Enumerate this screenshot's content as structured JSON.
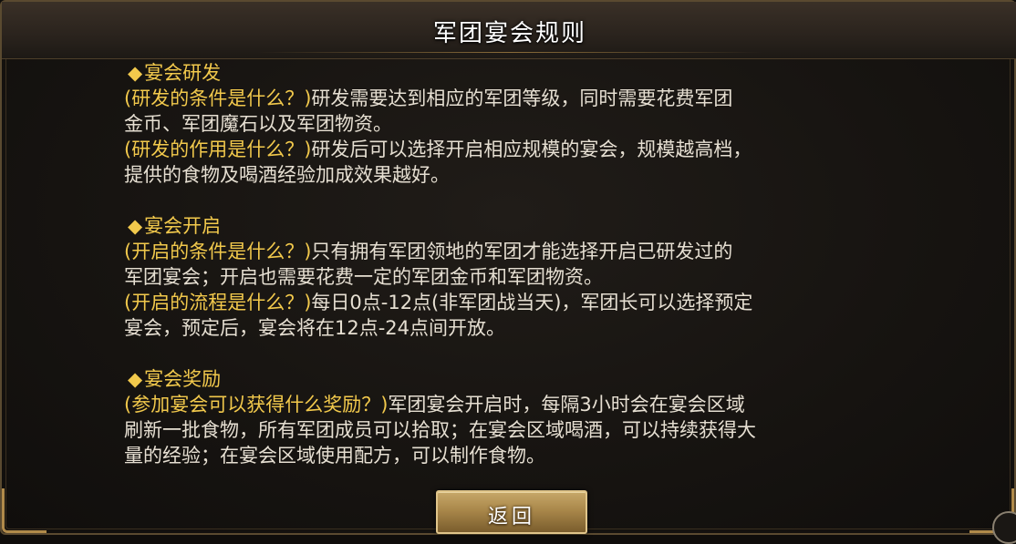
{
  "header": {
    "title": "军团宴会规则"
  },
  "sections": [
    {
      "heading": "宴会研发",
      "lines": [
        {
          "q": " (研发的条件是什么？)",
          "t": "研发需要达到相应的军团等级，同时需要花费军团"
        },
        {
          "q": "",
          "t": "金币、军团魔石以及军团物资。"
        },
        {
          "q": "(研发的作用是什么？)",
          "t": "研发后可以选择开启相应规模的宴会，规模越高档，"
        },
        {
          "q": "",
          "t": "提供的食物及喝酒经验加成效果越好。"
        }
      ]
    },
    {
      "heading": "宴会开启",
      "lines": [
        {
          "q": " (开启的条件是什么？)",
          "t": "只有拥有军团领地的军团才能选择开启已研发过的"
        },
        {
          "q": "",
          "t": "军团宴会；开启也需要花费一定的军团金币和军团物资。"
        },
        {
          "q": "(开启的流程是什么？)",
          "t": "每日0点-12点(非军团战当天)，军团长可以选择预定"
        },
        {
          "q": "",
          "t": "宴会，预定后，宴会将在12点-24点间开放。"
        }
      ]
    },
    {
      "heading": "宴会奖励",
      "lines": [
        {
          "q": "(参加宴会可以获得什么奖励？)",
          "t": "军团宴会开启时，每隔3小时会在宴会区域"
        },
        {
          "q": "",
          "t": "刷新一批食物，所有军团成员可以拾取；在宴会区域喝酒，可以持续获得大"
        },
        {
          "q": "",
          "t": "量的经验；在宴会区域使用配方，可以制作食物。"
        }
      ]
    }
  ],
  "bullet_icon": "diamond-bullet-icon",
  "footer": {
    "back_label": "返回"
  },
  "colors": {
    "accent": "#f2c94c",
    "body_text": "#e6dfd2",
    "button_gold": "#a9874a"
  }
}
